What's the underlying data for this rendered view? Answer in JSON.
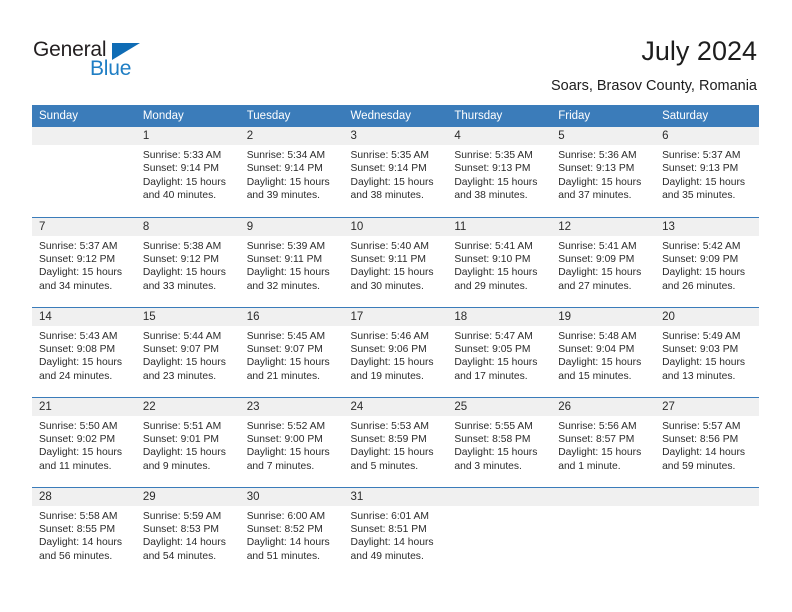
{
  "brand": {
    "word1": "General",
    "word2": "Blue",
    "triangle_color": "#0f6cb5",
    "word2_color": "#1f7ec4"
  },
  "header": {
    "title": "July 2024",
    "subtitle": "Soars, Brasov County, Romania",
    "accent_color": "#3b7cba",
    "daynum_band_color": "#f0f0f0"
  },
  "calendar": {
    "weekday_headers": [
      "Sunday",
      "Monday",
      "Tuesday",
      "Wednesday",
      "Thursday",
      "Friday",
      "Saturday"
    ],
    "weeks": [
      [
        {
          "day": "",
          "info": ""
        },
        {
          "day": "1",
          "info": "Sunrise: 5:33 AM\nSunset: 9:14 PM\nDaylight: 15 hours\nand 40 minutes."
        },
        {
          "day": "2",
          "info": "Sunrise: 5:34 AM\nSunset: 9:14 PM\nDaylight: 15 hours\nand 39 minutes."
        },
        {
          "day": "3",
          "info": "Sunrise: 5:35 AM\nSunset: 9:14 PM\nDaylight: 15 hours\nand 38 minutes."
        },
        {
          "day": "4",
          "info": "Sunrise: 5:35 AM\nSunset: 9:13 PM\nDaylight: 15 hours\nand 38 minutes."
        },
        {
          "day": "5",
          "info": "Sunrise: 5:36 AM\nSunset: 9:13 PM\nDaylight: 15 hours\nand 37 minutes."
        },
        {
          "day": "6",
          "info": "Sunrise: 5:37 AM\nSunset: 9:13 PM\nDaylight: 15 hours\nand 35 minutes."
        }
      ],
      [
        {
          "day": "7",
          "info": "Sunrise: 5:37 AM\nSunset: 9:12 PM\nDaylight: 15 hours\nand 34 minutes."
        },
        {
          "day": "8",
          "info": "Sunrise: 5:38 AM\nSunset: 9:12 PM\nDaylight: 15 hours\nand 33 minutes."
        },
        {
          "day": "9",
          "info": "Sunrise: 5:39 AM\nSunset: 9:11 PM\nDaylight: 15 hours\nand 32 minutes."
        },
        {
          "day": "10",
          "info": "Sunrise: 5:40 AM\nSunset: 9:11 PM\nDaylight: 15 hours\nand 30 minutes."
        },
        {
          "day": "11",
          "info": "Sunrise: 5:41 AM\nSunset: 9:10 PM\nDaylight: 15 hours\nand 29 minutes."
        },
        {
          "day": "12",
          "info": "Sunrise: 5:41 AM\nSunset: 9:09 PM\nDaylight: 15 hours\nand 27 minutes."
        },
        {
          "day": "13",
          "info": "Sunrise: 5:42 AM\nSunset: 9:09 PM\nDaylight: 15 hours\nand 26 minutes."
        }
      ],
      [
        {
          "day": "14",
          "info": "Sunrise: 5:43 AM\nSunset: 9:08 PM\nDaylight: 15 hours\nand 24 minutes."
        },
        {
          "day": "15",
          "info": "Sunrise: 5:44 AM\nSunset: 9:07 PM\nDaylight: 15 hours\nand 23 minutes."
        },
        {
          "day": "16",
          "info": "Sunrise: 5:45 AM\nSunset: 9:07 PM\nDaylight: 15 hours\nand 21 minutes."
        },
        {
          "day": "17",
          "info": "Sunrise: 5:46 AM\nSunset: 9:06 PM\nDaylight: 15 hours\nand 19 minutes."
        },
        {
          "day": "18",
          "info": "Sunrise: 5:47 AM\nSunset: 9:05 PM\nDaylight: 15 hours\nand 17 minutes."
        },
        {
          "day": "19",
          "info": "Sunrise: 5:48 AM\nSunset: 9:04 PM\nDaylight: 15 hours\nand 15 minutes."
        },
        {
          "day": "20",
          "info": "Sunrise: 5:49 AM\nSunset: 9:03 PM\nDaylight: 15 hours\nand 13 minutes."
        }
      ],
      [
        {
          "day": "21",
          "info": "Sunrise: 5:50 AM\nSunset: 9:02 PM\nDaylight: 15 hours\nand 11 minutes."
        },
        {
          "day": "22",
          "info": "Sunrise: 5:51 AM\nSunset: 9:01 PM\nDaylight: 15 hours\nand 9 minutes."
        },
        {
          "day": "23",
          "info": "Sunrise: 5:52 AM\nSunset: 9:00 PM\nDaylight: 15 hours\nand 7 minutes."
        },
        {
          "day": "24",
          "info": "Sunrise: 5:53 AM\nSunset: 8:59 PM\nDaylight: 15 hours\nand 5 minutes."
        },
        {
          "day": "25",
          "info": "Sunrise: 5:55 AM\nSunset: 8:58 PM\nDaylight: 15 hours\nand 3 minutes."
        },
        {
          "day": "26",
          "info": "Sunrise: 5:56 AM\nSunset: 8:57 PM\nDaylight: 15 hours\nand 1 minute."
        },
        {
          "day": "27",
          "info": "Sunrise: 5:57 AM\nSunset: 8:56 PM\nDaylight: 14 hours\nand 59 minutes."
        }
      ],
      [
        {
          "day": "28",
          "info": "Sunrise: 5:58 AM\nSunset: 8:55 PM\nDaylight: 14 hours\nand 56 minutes."
        },
        {
          "day": "29",
          "info": "Sunrise: 5:59 AM\nSunset: 8:53 PM\nDaylight: 14 hours\nand 54 minutes."
        },
        {
          "day": "30",
          "info": "Sunrise: 6:00 AM\nSunset: 8:52 PM\nDaylight: 14 hours\nand 51 minutes."
        },
        {
          "day": "31",
          "info": "Sunrise: 6:01 AM\nSunset: 8:51 PM\nDaylight: 14 hours\nand 49 minutes."
        },
        {
          "day": "",
          "info": ""
        },
        {
          "day": "",
          "info": ""
        },
        {
          "day": "",
          "info": ""
        }
      ]
    ]
  }
}
